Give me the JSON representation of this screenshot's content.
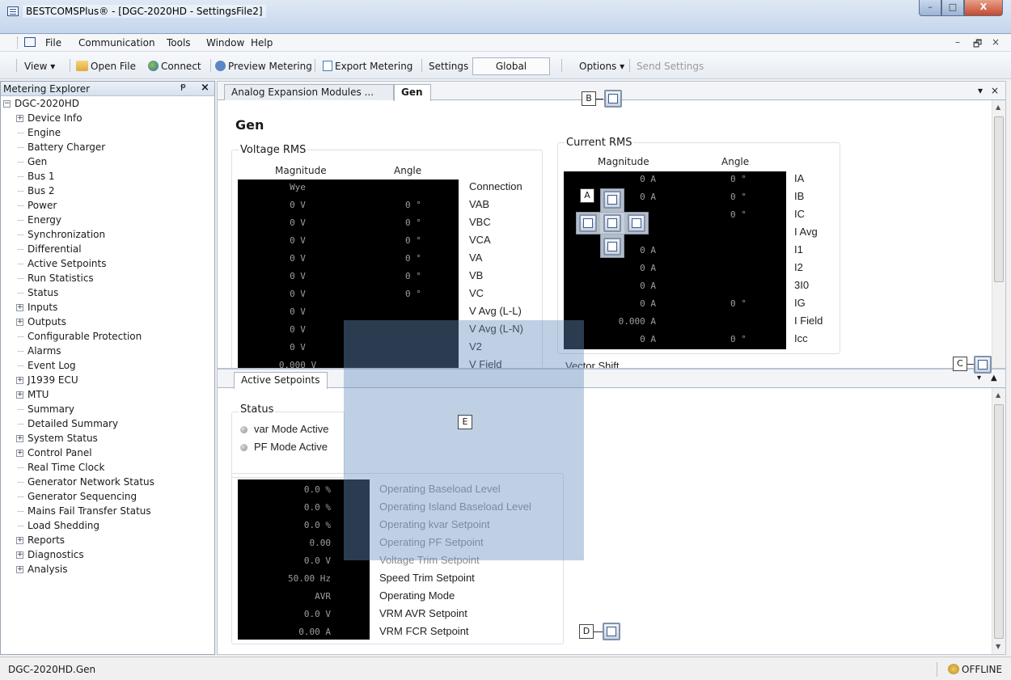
{
  "window": {
    "title": "BESTCOMSPlus® - [DGC-2020HD - SettingsFile2]",
    "controls": [
      "–",
      "□",
      "X"
    ]
  },
  "menu": {
    "items": [
      "File",
      "Communication",
      "Tools",
      "Window",
      "Help"
    ],
    "mdi_controls": [
      "–",
      "🗗",
      "×"
    ]
  },
  "toolbar": {
    "view": "View ▾",
    "open_file": "Open File",
    "connect": "Connect",
    "preview_metering": "Preview Metering",
    "export_metering": "Export Metering",
    "settings": "Settings",
    "global": "Global",
    "options": "Options ▾",
    "send_settings": "Send Settings"
  },
  "explorer": {
    "title": "Metering Explorer",
    "pin": "Ᵽ",
    "close": "×",
    "tree": [
      {
        "label": "DGC-2020HD",
        "level": 0,
        "expander": "−"
      },
      {
        "label": "Device Info",
        "level": 1,
        "expander": "+"
      },
      {
        "label": "Engine",
        "level": 1,
        "expander": ""
      },
      {
        "label": "Battery Charger",
        "level": 1,
        "expander": ""
      },
      {
        "label": "Gen",
        "level": 1,
        "expander": ""
      },
      {
        "label": "Bus 1",
        "level": 1,
        "expander": ""
      },
      {
        "label": "Bus 2",
        "level": 1,
        "expander": ""
      },
      {
        "label": "Power",
        "level": 1,
        "expander": ""
      },
      {
        "label": "Energy",
        "level": 1,
        "expander": ""
      },
      {
        "label": "Synchronization",
        "level": 1,
        "expander": ""
      },
      {
        "label": "Differential",
        "level": 1,
        "expander": ""
      },
      {
        "label": "Active Setpoints",
        "level": 1,
        "expander": ""
      },
      {
        "label": "Run Statistics",
        "level": 1,
        "expander": ""
      },
      {
        "label": "Status",
        "level": 1,
        "expander": ""
      },
      {
        "label": "Inputs",
        "level": 1,
        "expander": "+"
      },
      {
        "label": "Outputs",
        "level": 1,
        "expander": "+"
      },
      {
        "label": "Configurable Protection",
        "level": 1,
        "expander": ""
      },
      {
        "label": "Alarms",
        "level": 1,
        "expander": ""
      },
      {
        "label": "Event Log",
        "level": 1,
        "expander": ""
      },
      {
        "label": "J1939 ECU",
        "level": 1,
        "expander": "+"
      },
      {
        "label": "MTU",
        "level": 1,
        "expander": "+"
      },
      {
        "label": "Summary",
        "level": 1,
        "expander": ""
      },
      {
        "label": "Detailed Summary",
        "level": 1,
        "expander": ""
      },
      {
        "label": "System Status",
        "level": 1,
        "expander": "+"
      },
      {
        "label": "Control Panel",
        "level": 1,
        "expander": "+"
      },
      {
        "label": "Real Time Clock",
        "level": 1,
        "expander": ""
      },
      {
        "label": "Generator Network Status",
        "level": 1,
        "expander": ""
      },
      {
        "label": "Generator Sequencing",
        "level": 1,
        "expander": ""
      },
      {
        "label": "Mains Fail Transfer Status",
        "level": 1,
        "expander": ""
      },
      {
        "label": "Load Shedding",
        "level": 1,
        "expander": ""
      },
      {
        "label": "Reports",
        "level": 1,
        "expander": "+"
      },
      {
        "label": "Diagnostics",
        "level": 1,
        "expander": "+"
      },
      {
        "label": "Analysis",
        "level": 1,
        "expander": "+"
      }
    ]
  },
  "top_doc": {
    "tabs": [
      "Analog Expansion Modules ...",
      "Gen"
    ],
    "tab_controls": [
      "▾",
      "×"
    ],
    "heading": "Gen",
    "voltage": {
      "title": "Voltage RMS",
      "col_magnitude": "Magnitude",
      "col_angle": "Angle",
      "rows": [
        {
          "mag": "Wye",
          "ang": "",
          "label": "Connection"
        },
        {
          "mag": "0 V",
          "ang": "0 °",
          "label": "VAB"
        },
        {
          "mag": "0 V",
          "ang": "0 °",
          "label": "VBC"
        },
        {
          "mag": "0 V",
          "ang": "0 °",
          "label": "VCA"
        },
        {
          "mag": "0 V",
          "ang": "0 °",
          "label": "VA"
        },
        {
          "mag": "0 V",
          "ang": "0 °",
          "label": "VB"
        },
        {
          "mag": "0 V",
          "ang": "0 °",
          "label": "VC"
        },
        {
          "mag": "0 V",
          "ang": "",
          "label": "V Avg (L-L)"
        },
        {
          "mag": "0 V",
          "ang": "",
          "label": "V Avg (L-N)"
        },
        {
          "mag": "0 V",
          "ang": "",
          "label": "V2"
        },
        {
          "mag": "0.000 V",
          "ang": "",
          "label": "V Field"
        }
      ]
    },
    "current": {
      "title": "Current RMS",
      "col_magnitude": "Magnitude",
      "col_angle": "Angle",
      "rows": [
        {
          "mag": "0 A",
          "ang": "0 °",
          "label": "IA"
        },
        {
          "mag": "0 A",
          "ang": "0 °",
          "label": "IB"
        },
        {
          "mag": "",
          "ang": "0 °",
          "label": "IC"
        },
        {
          "mag": "",
          "ang": "",
          "label": "I Avg"
        },
        {
          "mag": "0 A",
          "ang": "",
          "label": "I1"
        },
        {
          "mag": "0 A",
          "ang": "",
          "label": "I2"
        },
        {
          "mag": "0 A",
          "ang": "",
          "label": "3I0"
        },
        {
          "mag": "0 A",
          "ang": "0 °",
          "label": "IG"
        },
        {
          "mag": "0.000 A",
          "ang": "",
          "label": "I Field"
        },
        {
          "mag": "0 A",
          "ang": "0 °",
          "label": "Icc"
        }
      ]
    },
    "vector_shift": "Vector Shift"
  },
  "bottom_doc": {
    "tabs": [
      "Active Setpoints"
    ],
    "status_title": "Status",
    "status_items": [
      "var Mode Active",
      "PF Mode Active"
    ],
    "setpoints": [
      {
        "value": "0.0 %",
        "label": "Operating Baseload Level"
      },
      {
        "value": "0.0 %",
        "label": "Operating Island Baseload Level"
      },
      {
        "value": "0.0 %",
        "label": "Operating kvar Setpoint"
      },
      {
        "value": "0.00",
        "label": "Operating PF Setpoint"
      },
      {
        "value": "0.0 V",
        "label": "Voltage Trim Setpoint"
      },
      {
        "value": "50.00 Hz",
        "label": "Speed Trim Setpoint"
      },
      {
        "value": "AVR",
        "label": "Operating Mode"
      },
      {
        "value": "0.0 V",
        "label": "VRM AVR Setpoint"
      },
      {
        "value": "0.00 A",
        "label": "VRM FCR Setpoint"
      }
    ]
  },
  "dock_labels": {
    "a": "A",
    "b": "B",
    "c": "C",
    "d": "D",
    "e": "E"
  },
  "statusbar": {
    "left": "DGC-2020HD.Gen",
    "right": "OFFLINE"
  }
}
